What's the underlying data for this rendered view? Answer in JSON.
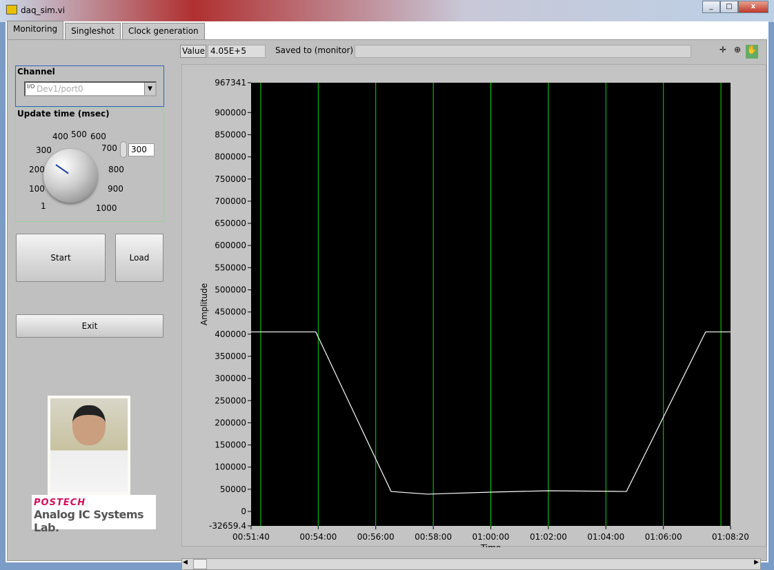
{
  "window": {
    "title": "daq_sim.vi",
    "minimize": "_",
    "maximize": "□",
    "close": "x"
  },
  "tabs": [
    {
      "label": "Monitoring",
      "active": true
    },
    {
      "label": "Singleshot"
    },
    {
      "label": "Clock generation"
    }
  ],
  "channel": {
    "label": "Channel",
    "value": "Dev1/port0",
    "io_prefix": "I/O"
  },
  "update_time": {
    "label": "Update time (msec)",
    "value": "300",
    "dial_labels": [
      "1",
      "100",
      "200",
      "300",
      "400",
      "500",
      "600",
      "700",
      "800",
      "900",
      "1000"
    ],
    "knob_value": 300
  },
  "buttons": {
    "start": "Start",
    "load": "Load",
    "exit": "Exit"
  },
  "toolbar": {
    "value_label": "Value",
    "value": "4.05E+5",
    "saved_label": "Saved to (monitor)",
    "saved_path": ""
  },
  "logo": {
    "brand": "POSTECH",
    "lab": "Analog IC Systems Lab.",
    "brand_color": "#d0105a"
  },
  "chart_data": {
    "type": "line",
    "xlabel": "Time",
    "ylabel": "Amplitude",
    "xlim": [
      "00:51:40",
      "01:08:20"
    ],
    "ylim": [
      -32659.4,
      967341
    ],
    "x_ticks": [
      "00:51:40",
      "00:54:00",
      "00:56:00",
      "00:58:00",
      "01:00:00",
      "01:02:00",
      "01:04:00",
      "01:06:00",
      "01:08:20"
    ],
    "y_ticks": [
      "967341",
      "900000",
      "850000",
      "800000",
      "750000",
      "700000",
      "650000",
      "600000",
      "550000",
      "500000",
      "450000",
      "400000",
      "350000",
      "300000",
      "250000",
      "200000",
      "150000",
      "100000",
      "50000",
      "0",
      "-32659.4"
    ],
    "grid": "vertical every 2 min",
    "background": "#000000",
    "grid_color": "#00e000",
    "line_color": "#ffffff",
    "points": [
      [
        "00:51:40",
        405000
      ],
      [
        "00:53:55",
        405000
      ],
      [
        "00:56:32",
        45000
      ],
      [
        "00:57:48",
        39000
      ],
      [
        "01:00:01",
        43500
      ],
      [
        "01:02:00",
        46700
      ],
      [
        "01:04:43",
        45000
      ],
      [
        "01:07:28",
        405000
      ],
      [
        "01:08:20",
        405000
      ]
    ]
  }
}
